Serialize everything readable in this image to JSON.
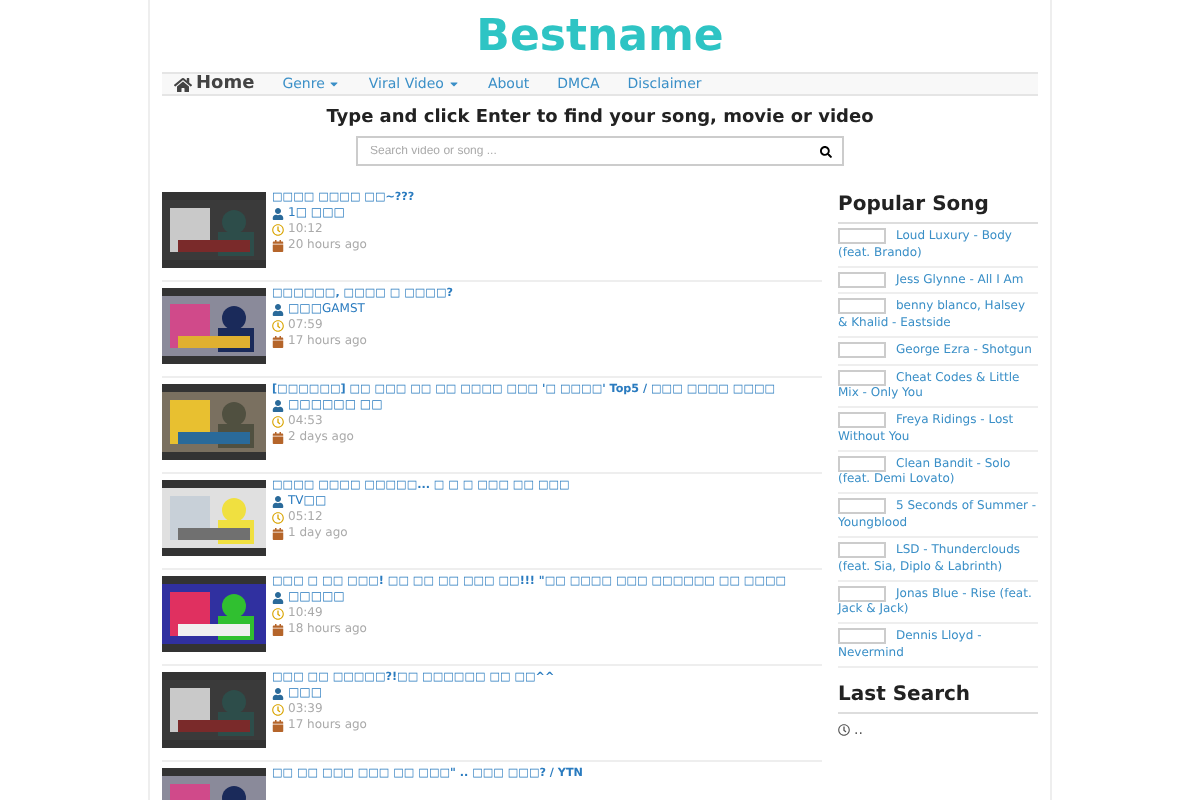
{
  "logo": "Bestname",
  "nav": [
    {
      "label": "Home",
      "kind": "home",
      "selected": true
    },
    {
      "label": "Genre",
      "kind": "dropdown",
      "selected": false
    },
    {
      "label": "Viral Video",
      "kind": "dropdown",
      "selected": false
    },
    {
      "label": "About",
      "kind": "link",
      "selected": false
    },
    {
      "label": "DMCA",
      "kind": "link",
      "selected": false
    },
    {
      "label": "Disclaimer",
      "kind": "link",
      "selected": false
    }
  ],
  "search": {
    "heading": "Type and click Enter to find your song, movie or video",
    "placeholder": "Search video or song ..."
  },
  "videos": [
    {
      "title": "□□□□ □□□□ □□~???",
      "channel": "1□ □□□",
      "duration": "10:12",
      "age": "20 hours ago"
    },
    {
      "title": "□□□□□□, □□□□ □ □□□□?",
      "channel": "□□□GAMST",
      "duration": "07:59",
      "age": "17 hours ago"
    },
    {
      "title": "[□□□□□□] □□ □□□ □□ □□ □□□□ □□□ '□ □□□□' Top5 / □□□ □□□□ □□□□",
      "channel": "□□□□□□ □□",
      "duration": "04:53",
      "age": "2 days ago"
    },
    {
      "title": "□□□□ □□□□ □□□□□... □ □ □ □□□ □□ □□□",
      "channel": "TV□□",
      "duration": "05:12",
      "age": "1 day ago"
    },
    {
      "title": "□□□ □ □□ □□□! □□ □□ □□ □□□ □□!!! \"□□ □□□□ □□□ □□□□□□ □□ □□□□",
      "channel": "□□□□□",
      "duration": "10:49",
      "age": "18 hours ago"
    },
    {
      "title": "□□□ □□ □□□□□?!□□ □□□□□□ □□ □□^^",
      "channel": "□□□",
      "duration": "03:39",
      "age": "17 hours ago"
    },
    {
      "title": "□□ □□ □□□ □□□ □□ □□□\" .. □□□ □□□? / YTN"
    }
  ],
  "popular": {
    "title": "Popular Song",
    "songs": [
      "Loud Luxury - Body (feat. Brando)",
      "Jess Glynne - All I Am",
      "benny blanco, Halsey & Khalid - Eastside",
      "George Ezra - Shotgun",
      "Cheat Codes & Little Mix - Only You",
      "Freya Ridings - Lost Without You",
      "Clean Bandit - Solo (feat. Demi Lovato)",
      "5 Seconds of Summer - Youngblood",
      "LSD - Thunderclouds (feat. Sia, Diplo & Labrinth)",
      "Jonas Blue - Rise (feat. Jack & Jack)",
      "Dennis Lloyd - Nevermind"
    ]
  },
  "last_search": {
    "title": "Last Search",
    "items": [
      ".."
    ]
  }
}
